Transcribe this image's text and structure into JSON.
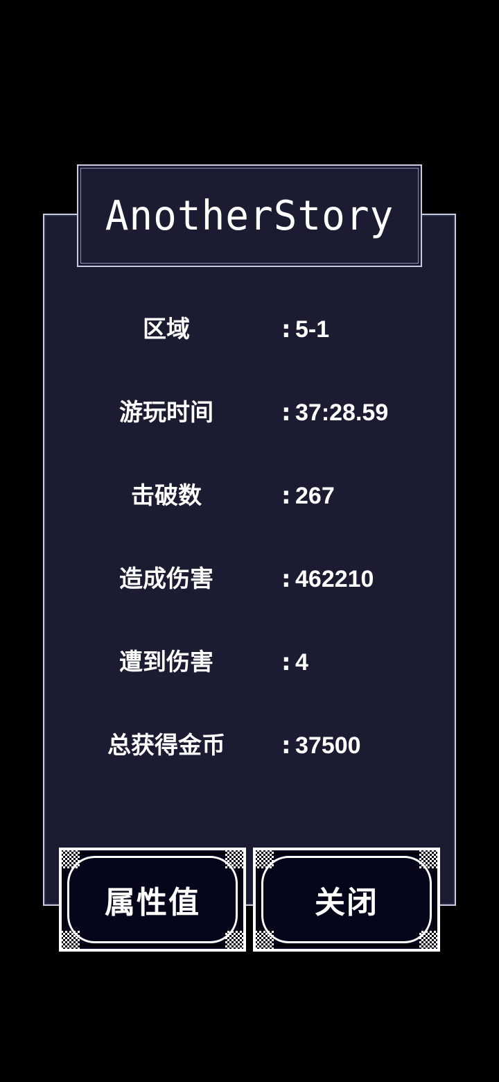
{
  "title": "AnotherStory",
  "stats": [
    {
      "label": "区域",
      "colon": ":",
      "value": "5-1"
    },
    {
      "label": "游玩时间",
      "colon": ":",
      "value": "37:28.59"
    },
    {
      "label": "击破数",
      "colon": ":",
      "value": "267"
    },
    {
      "label": "造成伤害",
      "colon": ":",
      "value": "462210"
    },
    {
      "label": "遭到伤害",
      "colon": ":",
      "value": "4"
    },
    {
      "label": "总获得金币",
      "colon": ":",
      "value": "37500"
    }
  ],
  "buttons": {
    "attributes_label": "属性值",
    "close_label": "关闭"
  },
  "colors": {
    "background": "#000000",
    "panel": "#1b1c32",
    "border": "#c9cbe0",
    "text": "#ffffff",
    "button_fill": "#06061a"
  }
}
